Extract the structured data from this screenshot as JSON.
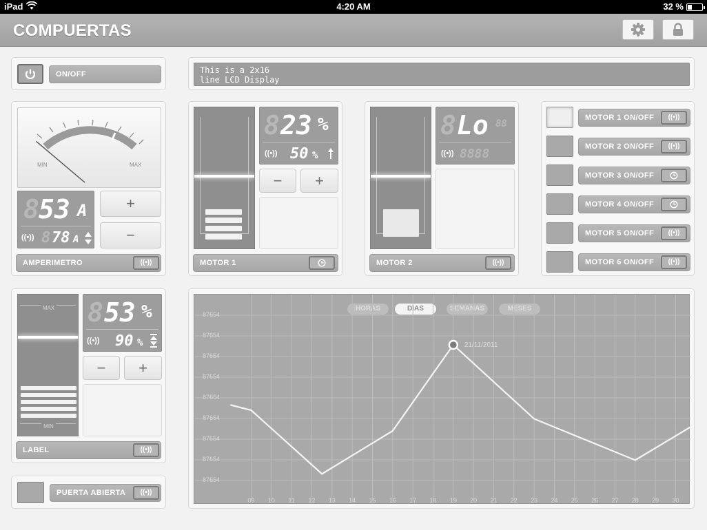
{
  "status_bar": {
    "carrier": "iPad",
    "time": "4:20 AM",
    "battery": "32 %",
    "battery_level": 0.32
  },
  "header": {
    "title": "COMPUERTAS",
    "buttons": [
      {
        "icon": "gear-icon"
      },
      {
        "icon": "lock-icon"
      }
    ]
  },
  "power": {
    "label": "ON/OFF",
    "icon": "power-icon"
  },
  "lcd_display": {
    "line1": "This is a 2x16",
    "line2": "line LCD Display"
  },
  "ammeter": {
    "min_label": "MIN",
    "max_label": "MAX",
    "needle_fraction": 0.12,
    "reading": "53",
    "unit": "A",
    "ghost": "8",
    "setpoint": "78",
    "setpoint_unit": "A",
    "setpoint_ghost": "8",
    "plus": "+",
    "minus": "−",
    "label": "AMPERIMETRO",
    "signal_text": "((•))"
  },
  "motor1": {
    "value": "23",
    "unit": "%",
    "ghost": "8",
    "setpoint": "50",
    "setpoint_unit": "%",
    "signal_text": "((•))",
    "minus": "−",
    "plus": "+",
    "label": "MOTOR 1",
    "fill_level": 0.23
  },
  "motor2": {
    "value": "Lo",
    "ghost": "8",
    "ghost_tail": "88",
    "ghost_setpoint": "8888",
    "signal_text": "((•))",
    "label": "MOTOR 2"
  },
  "motor_switches": [
    {
      "label": "MOTOR 1 ON/OFF",
      "icon": "signal-icon",
      "active": true
    },
    {
      "label": "MOTOR 2 ON/OFF",
      "icon": "signal-icon",
      "active": false
    },
    {
      "label": "MOTOR 3 ON/OFF",
      "icon": "clock-icon",
      "active": false
    },
    {
      "label": "MOTOR 4 ON/OFF",
      "icon": "clock-icon",
      "active": false
    },
    {
      "label": "MOTOR 5 ON/OFF",
      "icon": "signal-icon",
      "active": false
    },
    {
      "label": "MOTOR 6 ON/OFF",
      "icon": "signal-icon",
      "active": false
    }
  ],
  "level": {
    "max_label": "MAX",
    "min_label": "MIN",
    "value": "53",
    "unit": "%",
    "ghost": "8",
    "setpoint": "90",
    "setpoint_unit": "%",
    "signal_text": "((•))",
    "minus": "−",
    "plus": "+",
    "label": "LABEL",
    "fill_level": 0.53
  },
  "door": {
    "label": "PUERTA ABIERTA",
    "signal_text": "((•))"
  },
  "chart_tabs": [
    "HORAS",
    "DIAS",
    "SEMANAS",
    "MESES"
  ],
  "chart_active_tab": "DIAS",
  "chart_data": {
    "type": "line",
    "title": "",
    "xlabel": "",
    "ylabel": "",
    "x_ticks": [
      "09",
      "10",
      "11",
      "12",
      "13",
      "14",
      "15",
      "16",
      "17",
      "18",
      "19",
      "20",
      "21",
      "22",
      "23",
      "24",
      "25",
      "26",
      "27",
      "28",
      "29",
      "30"
    ],
    "y_ticks": [
      "87654",
      "87654",
      "87654",
      "87654",
      "87654",
      "87654",
      "87654",
      "87654",
      "87654"
    ],
    "x": [
      8,
      9,
      12.5,
      16,
      19,
      23,
      28,
      30.7
    ],
    "y": [
      0.51,
      0.48,
      0.11,
      0.36,
      0.86,
      0.43,
      0.19,
      0.38
    ],
    "xlim": [
      7.55,
      30.7
    ],
    "ylim": [
      0,
      1
    ],
    "highlight": {
      "x": 19,
      "label": "21/11/2011"
    },
    "grid": true
  }
}
